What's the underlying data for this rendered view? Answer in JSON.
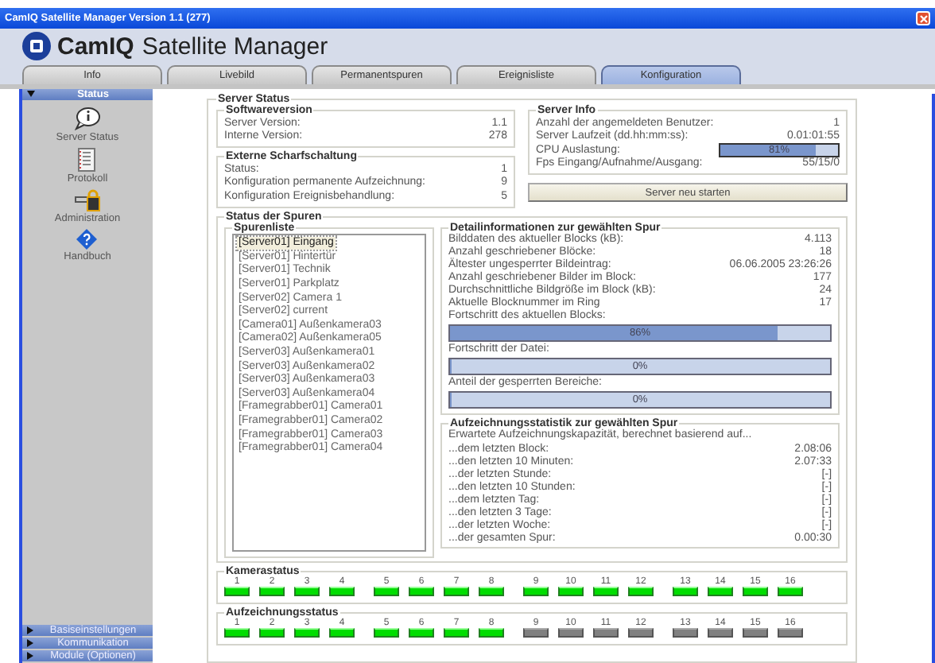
{
  "window": {
    "title": "CamIQ Satellite Manager Version 1.1 (277)"
  },
  "header": {
    "brand": "CamIQ",
    "product": "Satellite Manager"
  },
  "tabs": [
    {
      "label": "Info",
      "selected": false
    },
    {
      "label": "Livebild",
      "selected": false
    },
    {
      "label": "Permanentspuren",
      "selected": false
    },
    {
      "label": "Ereignisliste",
      "selected": false
    },
    {
      "label": "Konfiguration",
      "selected": true
    }
  ],
  "sidebar": {
    "section": {
      "label": "Status",
      "expanded": true
    },
    "items": [
      {
        "kind": "bubble",
        "label": "Server Status"
      },
      {
        "kind": "document",
        "label": "Protokoll"
      },
      {
        "kind": "padlock",
        "label": "Administration"
      },
      {
        "kind": "help",
        "label": "Handbuch"
      }
    ],
    "sections": [
      {
        "label": "Basiseinstellungen",
        "expanded": false
      },
      {
        "label": "Kommunikation",
        "expanded": false
      },
      {
        "label": "Module (Optionen)",
        "expanded": false
      }
    ]
  },
  "server_status": {
    "title": "Server Status",
    "softwareversion": {
      "title": "Softwareversion",
      "rows": [
        {
          "label": "Server Version:",
          "value": "1.1"
        },
        {
          "label": "Interne Version:",
          "value": "278"
        }
      ]
    },
    "externe": {
      "title": "Externe Scharfschaltung",
      "rows": [
        {
          "label": "Status:",
          "value": "1"
        },
        {
          "label": "Konfiguration permanente Aufzeichnung:",
          "value": "9"
        },
        {
          "label": "Konfiguration Ereignisbehandlung:",
          "value": "5"
        }
      ]
    },
    "server_info": {
      "title": "Server Info",
      "rows": [
        {
          "kind": "text",
          "label": "Anzahl der angemeldeten Benutzer:",
          "value": "1"
        },
        {
          "kind": "text",
          "label": "Server Laufzeit (dd.hh:mm:ss):",
          "value": "0.01:01:55"
        },
        {
          "kind": "meter",
          "label": "CPU Auslastung:",
          "level": 0.81,
          "reading": "81%"
        },
        {
          "kind": "text",
          "label": "Fps Eingang/Aufnahme/Ausgang:",
          "value": "55/15/0"
        }
      ]
    },
    "restart_button": "Server neu starten"
  },
  "spuren": {
    "title": "Status der Spuren",
    "list_title": "Spurenliste",
    "items": [
      {
        "label": "[Server01] Eingang",
        "selected": true
      },
      {
        "label": "[Server01] Hintertür",
        "selected": false
      },
      {
        "label": "[Server01] Technik",
        "selected": false
      },
      {
        "label": "[Server01] Parkplatz",
        "selected": false
      },
      {
        "label": "[Server02] Camera 1",
        "selected": false
      },
      {
        "label": "[Server02] current",
        "selected": false
      },
      {
        "label": "[Camera01] Außenkamera03",
        "selected": false
      },
      {
        "label": "[Camera02] Außenkamera05",
        "selected": false
      },
      {
        "label": "[Server03] Außenkamera01",
        "selected": false
      },
      {
        "label": "[Server03] Außenkamera02",
        "selected": false
      },
      {
        "label": "[Server03] Außenkamera03",
        "selected": false
      },
      {
        "label": "[Server03] Außenkamera04",
        "selected": false
      },
      {
        "label": "[Framegrabber01] Camera01",
        "selected": false
      },
      {
        "label": "[Framegrabber01] Camera02",
        "selected": false
      },
      {
        "label": "[Framegrabber01] Camera03",
        "selected": false
      },
      {
        "label": "[Framegrabber01] Camera04",
        "selected": false
      }
    ],
    "detail": {
      "title": "Detailinformationen zur gewählten Spur",
      "rows": [
        {
          "label": "Bilddaten des aktueller Blocks (kB):",
          "value": "4.113"
        },
        {
          "label": "Anzahl geschriebener Blöcke:",
          "value": "18"
        },
        {
          "label": "Ältester ungesperrter Bildeintrag:",
          "value": "06.06.2005 23:26:26"
        },
        {
          "label": "Anzahl geschriebener Bilder im Block:",
          "value": "177"
        },
        {
          "label": "Durchschnittliche Bildgröße im Block (kB):",
          "value": "24"
        },
        {
          "label": "Aktuelle Blocknummer im Ring",
          "value": "17"
        }
      ],
      "bars": [
        {
          "label": "Fortschritt des aktuellen Blocks:",
          "level": 0.86,
          "reading": "86%"
        },
        {
          "label": "Fortschritt der Datei:",
          "level": 0,
          "reading": "0%"
        },
        {
          "label": "Anteil der gesperrten Bereiche:",
          "level": 0,
          "reading": "0%"
        }
      ]
    },
    "statistik": {
      "title": "Aufzeichnungsstatistik zur gewählten Spur",
      "intro": "Erwartete Aufzeichnungskapazität, berechnet basierend auf...",
      "rows": [
        {
          "label": "...dem letzten Block:",
          "value": "2.08:06"
        },
        {
          "label": "...den letzten 10 Minuten:",
          "value": "2.07:33"
        },
        {
          "label": "...der letzten Stunde:",
          "value": "[-]"
        },
        {
          "label": "...den letzten 10 Stunden:",
          "value": "[-]"
        },
        {
          "label": "...dem letzten Tag:",
          "value": "[-]"
        },
        {
          "label": "...den letzten 3 Tage:",
          "value": "[-]"
        },
        {
          "label": "...der letzten Woche:",
          "value": "[-]"
        },
        {
          "label": "...der gesamten Spur:",
          "value": "0.00:30"
        }
      ]
    }
  },
  "kamerastatus": {
    "title": "Kamerastatus",
    "leds": [
      {
        "label": "1",
        "on": true
      },
      {
        "label": "2",
        "on": true
      },
      {
        "label": "3",
        "on": true
      },
      {
        "label": "4",
        "on": true
      },
      {
        "label": "5",
        "on": true
      },
      {
        "label": "6",
        "on": true
      },
      {
        "label": "7",
        "on": true
      },
      {
        "label": "8",
        "on": true
      },
      {
        "label": "9",
        "on": true
      },
      {
        "label": "10",
        "on": true
      },
      {
        "label": "11",
        "on": true
      },
      {
        "label": "12",
        "on": true
      },
      {
        "label": "13",
        "on": true
      },
      {
        "label": "14",
        "on": true
      },
      {
        "label": "15",
        "on": true
      },
      {
        "label": "16",
        "on": true
      }
    ]
  },
  "aufzeichnungsstatus": {
    "title": "Aufzeichnungsstatus",
    "leds": [
      {
        "label": "1",
        "on": true
      },
      {
        "label": "2",
        "on": true
      },
      {
        "label": "3",
        "on": true
      },
      {
        "label": "4",
        "on": true
      },
      {
        "label": "5",
        "on": true
      },
      {
        "label": "6",
        "on": true
      },
      {
        "label": "7",
        "on": true
      },
      {
        "label": "8",
        "on": true
      },
      {
        "label": "9",
        "on": false
      },
      {
        "label": "10",
        "on": false
      },
      {
        "label": "11",
        "on": false
      },
      {
        "label": "12",
        "on": false
      },
      {
        "label": "13",
        "on": false
      },
      {
        "label": "14",
        "on": false
      },
      {
        "label": "15",
        "on": false
      },
      {
        "label": "16",
        "on": false
      }
    ]
  }
}
